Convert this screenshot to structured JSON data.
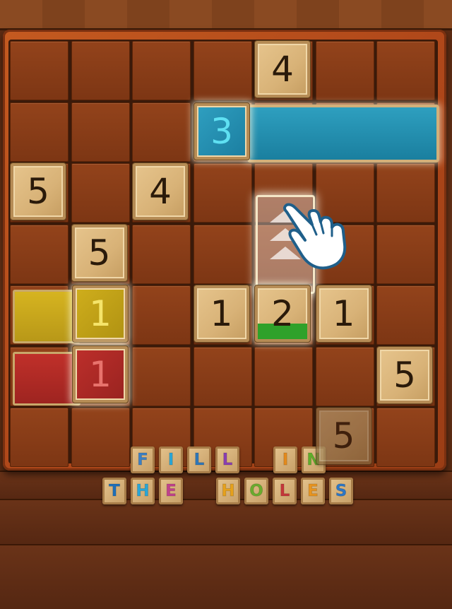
{
  "game": {
    "board": {
      "rows": 7,
      "cols": 7,
      "tiles": [
        {
          "row": 0,
          "col": 4,
          "value": "4"
        },
        {
          "row": 2,
          "col": 0,
          "value": "5"
        },
        {
          "row": 2,
          "col": 2,
          "value": "4"
        },
        {
          "row": 3,
          "col": 1,
          "value": "5"
        },
        {
          "row": 4,
          "col": 3,
          "value": "1"
        },
        {
          "row": 4,
          "col": 5,
          "value": "1"
        },
        {
          "row": 5,
          "col": 6,
          "value": "5"
        },
        {
          "row": 6,
          "col": 5,
          "value": "5"
        }
      ],
      "active_tiles": {
        "blue": {
          "value": "3",
          "color": "#1f8cb0"
        },
        "yellow": {
          "value": "1",
          "color": "#c9a81a"
        },
        "red": {
          "value": "1",
          "color": "#b02a26"
        },
        "green": {
          "value": "2",
          "color": "#2fa12a"
        }
      }
    },
    "hint": {
      "icon": "pointer-hand-icon",
      "direction": "up"
    },
    "title": {
      "line1_word1": [
        "F",
        "I",
        "L",
        "L"
      ],
      "line1_word2": [
        "I",
        "N"
      ],
      "line2_word1": [
        "T",
        "H",
        "E"
      ],
      "line2_word2": [
        "H",
        "O",
        "L",
        "E",
        "S"
      ],
      "letter_colors": {
        "F": "#3b7fc4",
        "I": "#2aa6d6",
        "L1": "#2f77b8",
        "L2": "#8a3fb0",
        "I2": "#e48a1c",
        "N": "#5fae2a",
        "T": "#1f6fb8",
        "H": "#2aa6d6",
        "E": "#c0418c",
        "H2": "#e6a11c",
        "O": "#6aab2e",
        "L3": "#c4373a",
        "E2": "#e8941f",
        "S": "#2d77c6"
      }
    }
  }
}
